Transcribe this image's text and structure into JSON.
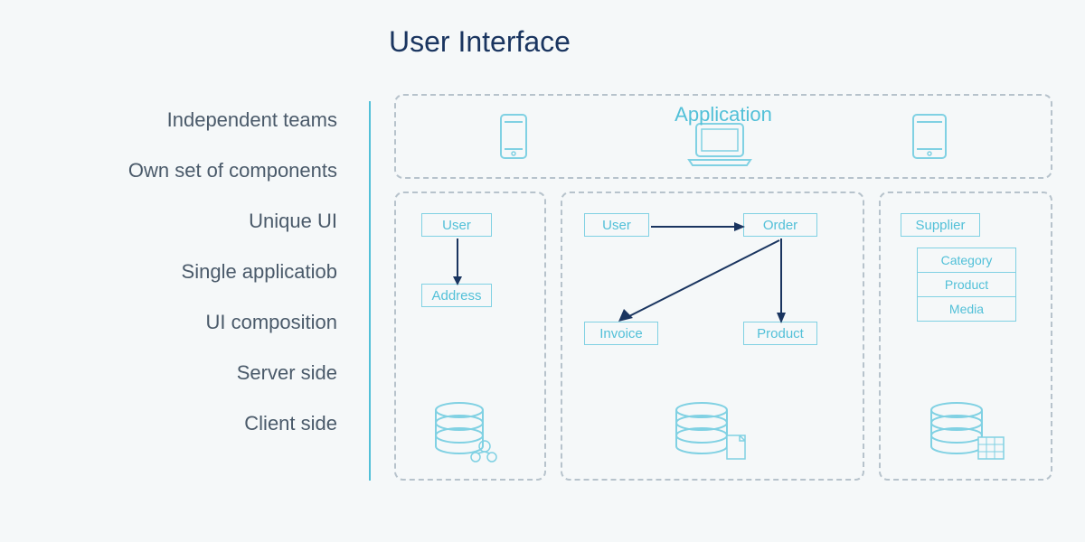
{
  "title": "User Interface",
  "sidebar": {
    "items": [
      "Independent teams",
      "Own set of components",
      "Unique UI",
      "Single applicatiob",
      "UI composition",
      "Server side",
      "Client side"
    ]
  },
  "app_row": {
    "label": "Application"
  },
  "services": {
    "svc1": {
      "entities": [
        "User",
        "Address"
      ]
    },
    "svc2": {
      "entities": [
        "User",
        "Order",
        "Invoice",
        "Product"
      ]
    },
    "svc3": {
      "entities": [
        "Supplier"
      ],
      "stack": [
        "Category",
        "Product",
        "Media"
      ]
    }
  },
  "colors": {
    "accent": "#52c0d8",
    "entity_border": "#80d1e3",
    "dashed": "#b7c3cc",
    "title": "#1a3560",
    "text": "#4a5a6a",
    "arrow": "#1a3560"
  }
}
